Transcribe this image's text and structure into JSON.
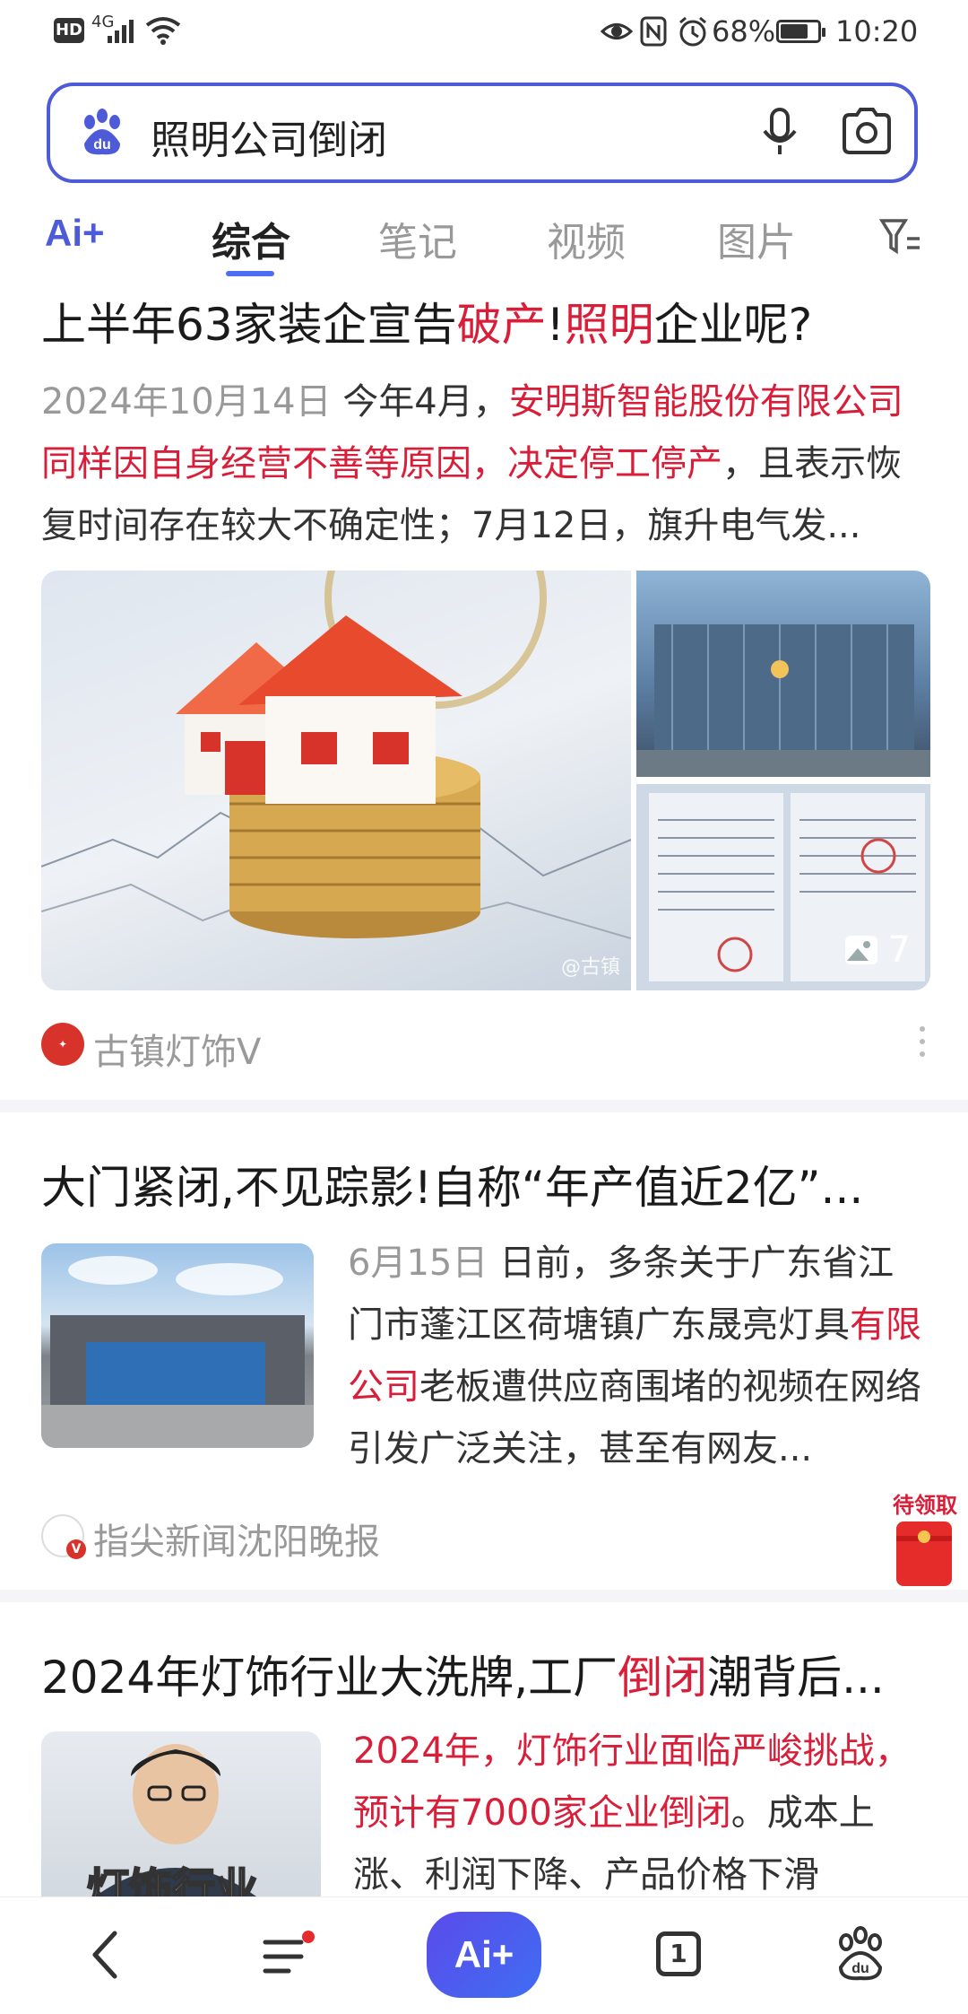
{
  "status_bar": {
    "left_badges": "HD",
    "network": "4G",
    "battery": "68%",
    "time": "10:20"
  },
  "search": {
    "query": "照明公司倒闭"
  },
  "tabs": {
    "ai_label": "Ai+",
    "items": [
      "综合",
      "笔记",
      "视频",
      "图片"
    ],
    "active": "综合"
  },
  "results": [
    {
      "title_pre": "上半年63家装企宣告",
      "title_red1": "破产",
      "title_mid": "!",
      "title_red2": "照明",
      "title_post": "企业呢?",
      "date": "2024年10月14日",
      "snippet_a": " 今年4月，",
      "snippet_red": "安明斯智能股份有限公司同样因自身经营不善等原因，决定停工停产",
      "snippet_b": "，且表示恢复时间存在较大不确定性；7月12日，旗升电气发...",
      "image_count": "7",
      "source": "古镇灯饰V",
      "watermark": "@古镇"
    },
    {
      "title": "大门紧闭,不见踪影!自称“年产值近2亿”...",
      "date": "6月15日",
      "snippet_a": " 日前，多条关于广东省江门市蓬江区荷塘镇广东晟亮灯具",
      "snippet_red": "有限公司",
      "snippet_b": "老板遭供应商围堵的视频在网络引发广泛关注，甚至有网友...",
      "source": "指尖新闻沈阳晚报",
      "red_packet_label": "待领取"
    },
    {
      "title_pre": "2024年灯饰行业大洗牌,工厂",
      "title_red": "倒闭",
      "title_post": "潮背后...",
      "snippet_red": "2024年，灯饰行业面临严峻挑战，预计有7000家企业倒闭",
      "snippet_b": "。成本上涨、利润下降、产品价格下滑",
      "thumb_caption": "灯饰行业"
    }
  ],
  "bottom_nav": {
    "ai_label": "Ai+",
    "tabs_count": "1"
  },
  "colors": {
    "accent": "#4e6ef2",
    "highlight_red": "#d91e3a"
  }
}
